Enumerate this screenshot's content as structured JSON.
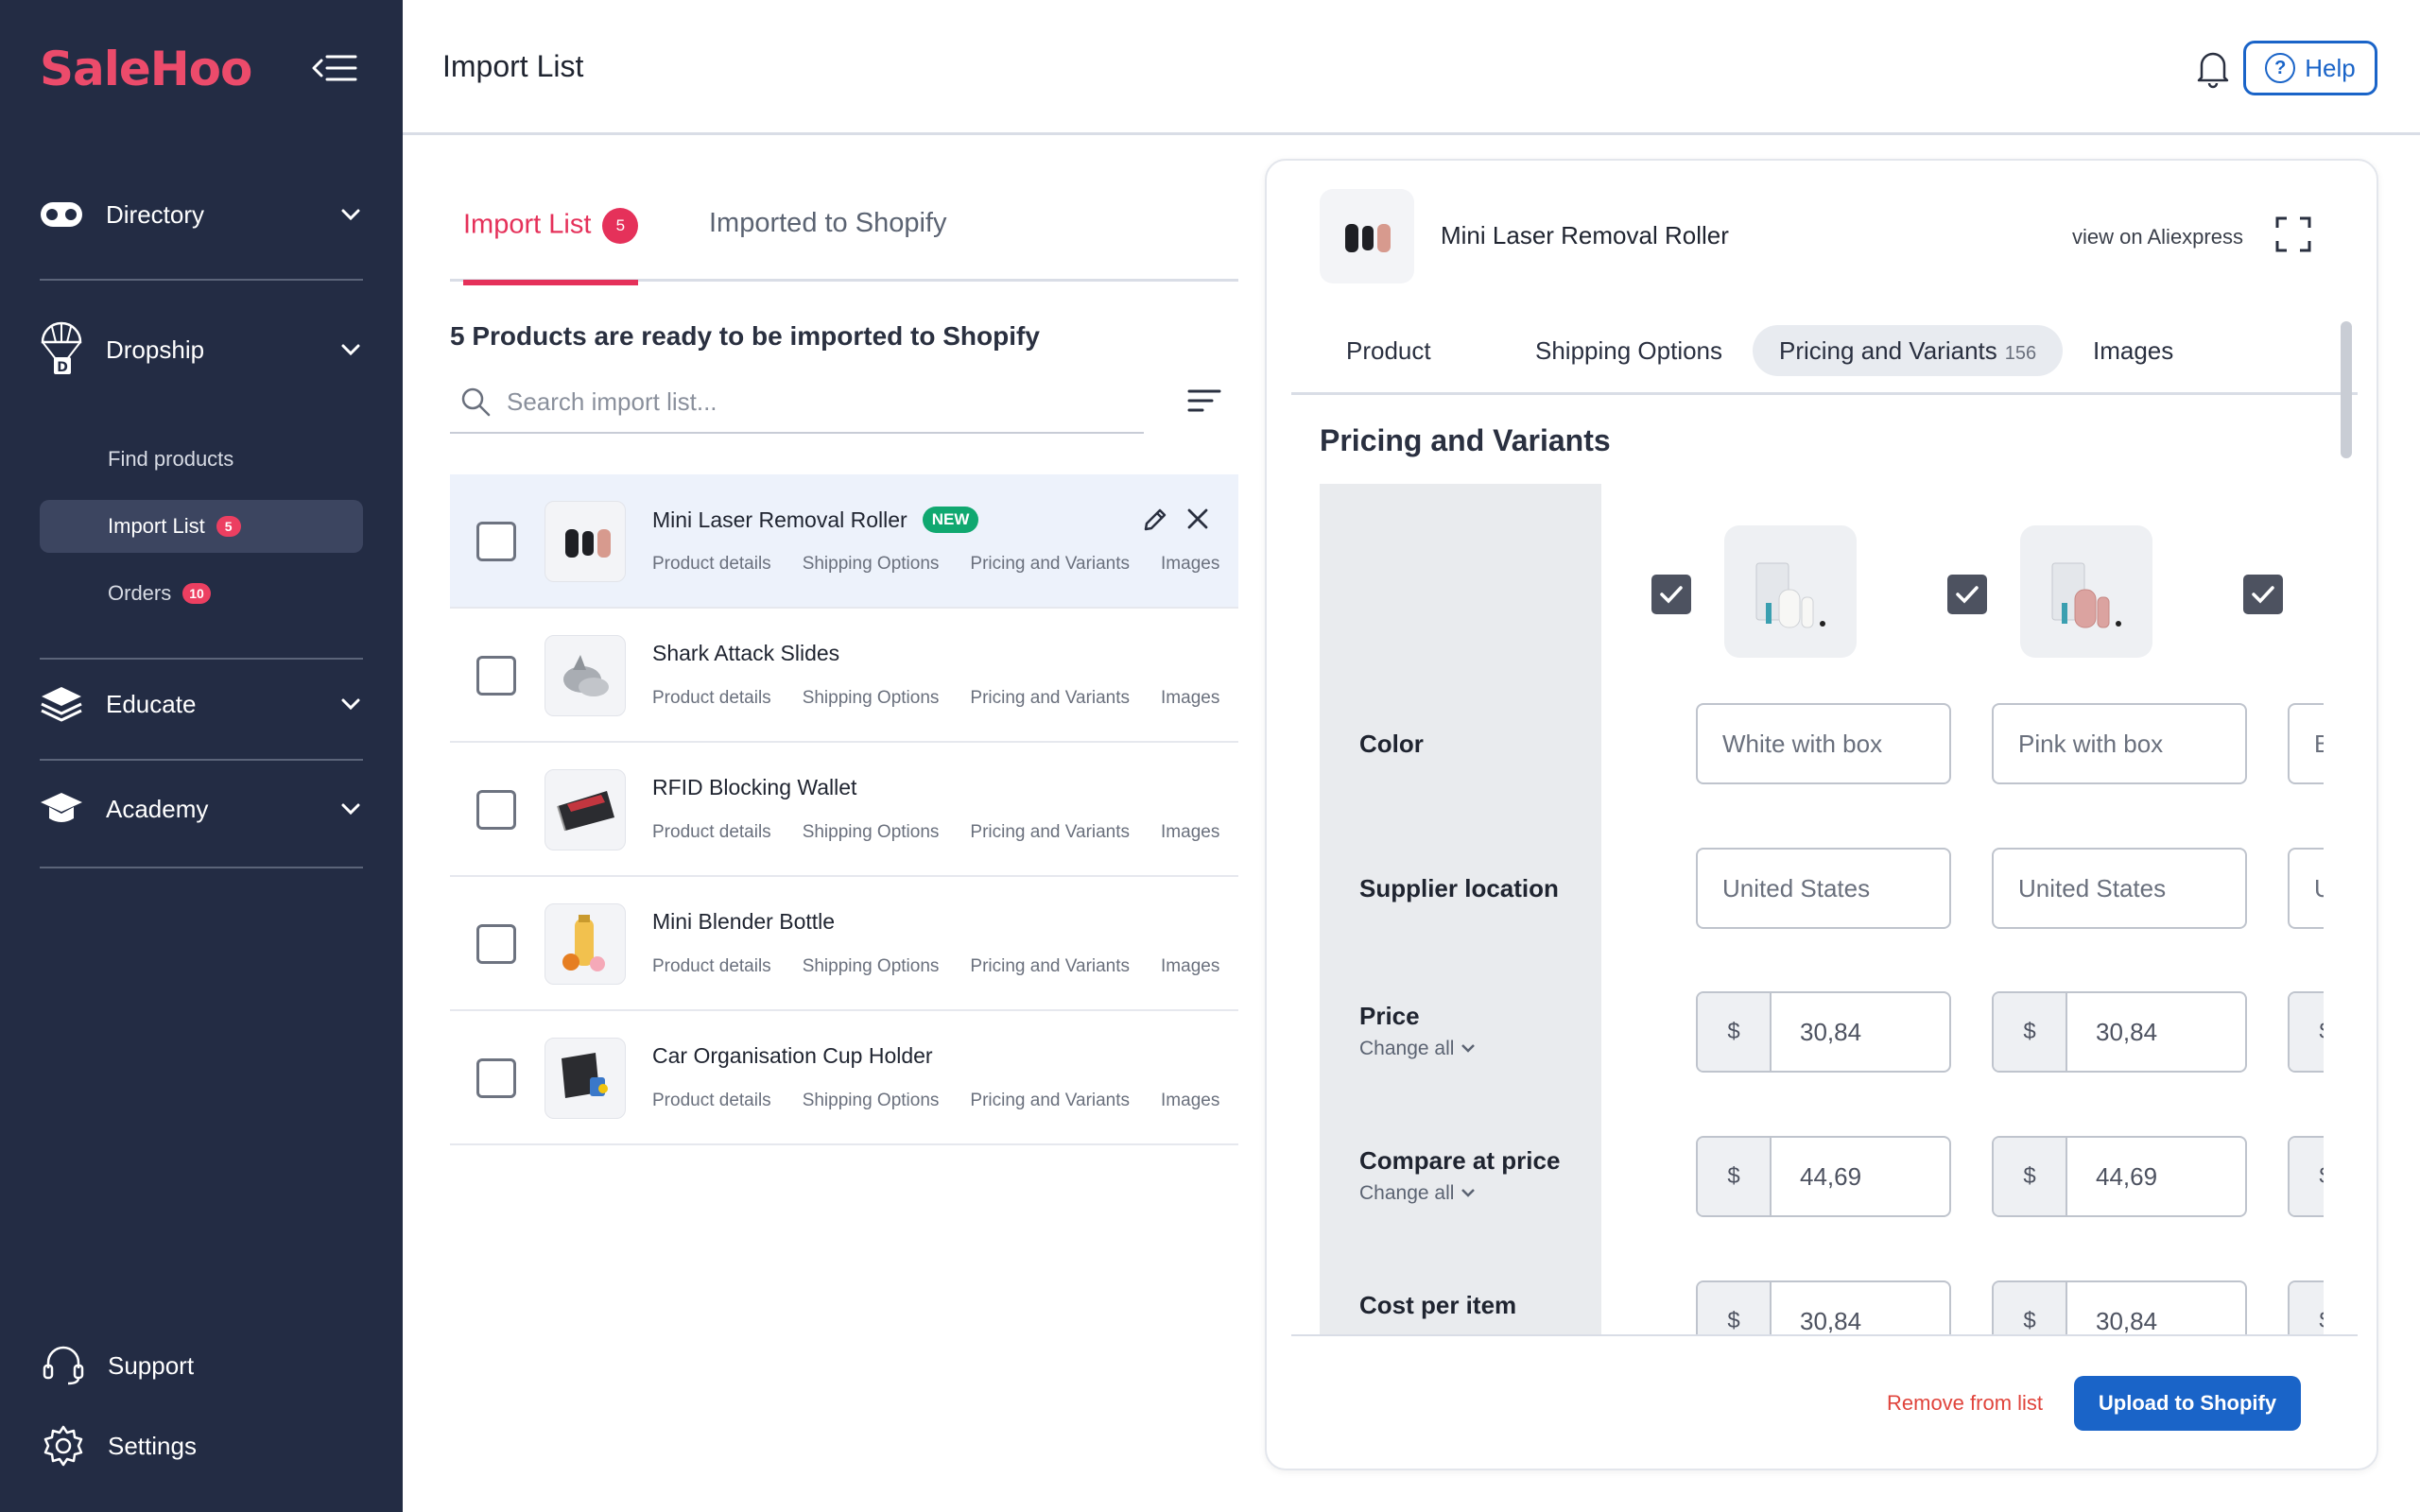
{
  "brand": {
    "name": "SaleHoo",
    "accent": "#ec4b6b",
    "sidebar_bg": "#232c44",
    "primary_blue": "#1a64c8"
  },
  "sidebar": {
    "sections": [
      {
        "label": "Directory",
        "icon": "mask-icon"
      },
      {
        "label": "Dropship",
        "icon": "parachute-icon"
      },
      {
        "label": "Educate",
        "icon": "layers-icon"
      },
      {
        "label": "Academy",
        "icon": "graduation-cap-icon"
      }
    ],
    "dropship_items": [
      {
        "label": "Find products"
      },
      {
        "label": "Import List",
        "badge": "5",
        "active": true
      },
      {
        "label": "Orders",
        "badge": "10"
      }
    ],
    "bottom": [
      {
        "label": "Support",
        "icon": "headset-icon"
      },
      {
        "label": "Settings",
        "icon": "gear-icon"
      }
    ]
  },
  "header": {
    "title": "Import List",
    "help_label": "Help",
    "help_icon": "?"
  },
  "list_pane": {
    "tabs": [
      {
        "label": "Import List",
        "badge": "5",
        "active": true
      },
      {
        "label": "Imported to Shopify"
      }
    ],
    "ready_text": "5 Products are ready to be imported to Shopify",
    "search_placeholder": "Search import list...",
    "link_labels": [
      "Product details",
      "Shipping Options",
      "Pricing and Variants",
      "Images"
    ],
    "products": [
      {
        "name": "Mini Laser Removal Roller",
        "badge": "NEW",
        "selected": true
      },
      {
        "name": "Shark Attack Slides"
      },
      {
        "name": "RFID Blocking Wallet"
      },
      {
        "name": "Mini Blender Bottle"
      },
      {
        "name": "Car Organisation Cup Holder"
      }
    ]
  },
  "detail": {
    "product_name": "Mini Laser Removal Roller",
    "view_link": "view on Aliexpress",
    "tabs": [
      {
        "label": "Product"
      },
      {
        "label": "Shipping Options"
      },
      {
        "label": "Pricing and Variants",
        "count": "156",
        "active": true
      },
      {
        "label": "Images"
      }
    ],
    "section_title": "Pricing and Variants",
    "row_labels": {
      "color": "Color",
      "supplier_location": "Supplier location",
      "price": "Price",
      "compare_at_price": "Compare at price",
      "cost_per_item": "Cost per item",
      "change_all": "Change all"
    },
    "currency": "$",
    "variants": [
      {
        "checked": true,
        "color": "White with box",
        "location": "United States",
        "price": "30,84",
        "compare": "44,69",
        "cost": "30,84"
      },
      {
        "checked": true,
        "color": "Pink with box",
        "location": "United States",
        "price": "30,84",
        "compare": "44,69",
        "cost": "30,84"
      },
      {
        "checked": true,
        "color": "Black with box",
        "location": "United States",
        "price": "",
        "compare": "",
        "cost": ""
      }
    ],
    "remove_label": "Remove from list",
    "upload_label": "Upload to Shopify"
  }
}
